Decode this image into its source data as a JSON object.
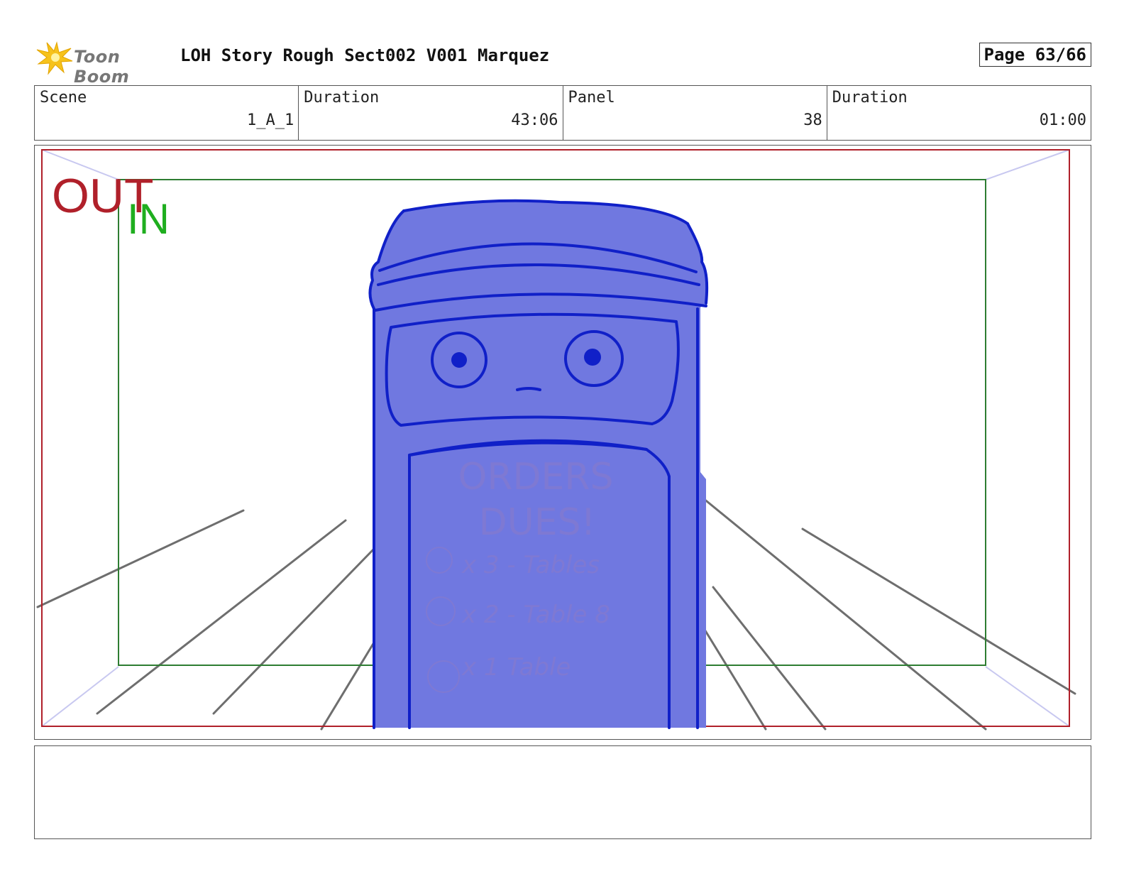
{
  "header": {
    "logo_text": "Toon Boom",
    "title": "LOH Story Rough Sect002 V001 Marquez",
    "page_label": "Page 63/66"
  },
  "info": {
    "scene_label": "Scene",
    "scene_value": "1_A_1",
    "duration_label": "Duration",
    "duration_value": "43:06",
    "panel_label": "Panel",
    "panel_value": "38",
    "panel_duration_label": "Duration",
    "panel_duration_value": "01:00"
  },
  "panel": {
    "out_label": "OUT",
    "in_label": "IN",
    "sign_lines": [
      "ORDERS",
      "DUES!",
      "x 3 - Tables",
      "x 2 - Table 8",
      "x 1 Table"
    ]
  },
  "colors": {
    "out_frame": "#b0202a",
    "in_frame": "#2e7d32",
    "character_fill": "#7078e0",
    "character_stroke": "#1020c8"
  }
}
